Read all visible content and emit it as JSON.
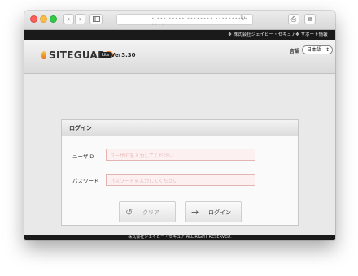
{
  "browser": {
    "url_text": "• ••• ••••• •••••••• •••••••••• ••••",
    "nav_back": "‹",
    "nav_forward": "›",
    "sidebar_icon": "sidebar-icon",
    "reload_icon": "↻",
    "share_icon": "⎙",
    "tabs_icon": "⧉"
  },
  "top_links": {
    "company": "❖ 株式会社ジェイビー・セキュア",
    "support": "❖ サポート情報"
  },
  "header": {
    "logo_main": "SITEGUAR",
    "logo_accent": "D",
    "lite_badge": "Lite",
    "version": "Ver3.30",
    "language_label": "言語",
    "language_value": "日本語",
    "language_arrow": "↕"
  },
  "login": {
    "title": "ログイン",
    "user_label": "ユーザID",
    "user_placeholder": "ユーザIDを入力してください",
    "password_label": "パスワード",
    "password_placeholder": "パスワードを入力してください",
    "clear_button": "クリア",
    "login_button": "ログイン",
    "clear_icon": "↺",
    "login_icon": "→"
  },
  "footer": {
    "text": "株式会社ジェイビー・セキュア ALL RIGHT RESERVED."
  },
  "colors": {
    "accent_orange": "#e8731c",
    "field_bg": "#fdf0f0",
    "field_border": "#e3b4b4",
    "dark_strip": "#1a1a1a"
  }
}
